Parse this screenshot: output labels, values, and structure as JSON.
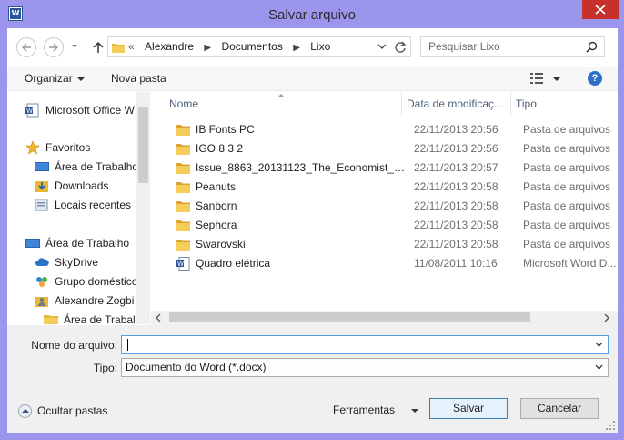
{
  "window": {
    "title": "Salvar arquivo",
    "app_icon_letter": "W"
  },
  "address_bar": {
    "overflow": "«",
    "crumbs": [
      "Alexandre",
      "Documentos",
      "Lixo"
    ]
  },
  "search": {
    "placeholder": "Pesquisar Lixo"
  },
  "toolbar": {
    "organize_label": "Organizar",
    "new_folder_label": "Nova pasta"
  },
  "nav_pane": {
    "items": [
      {
        "label": "Microsoft Office W",
        "icon": "word-doc-icon"
      },
      {
        "label": "Favoritos",
        "icon": "star-icon"
      },
      {
        "label": "Área de Trabalho",
        "icon": "desktop-icon"
      },
      {
        "label": "Downloads",
        "icon": "downloads-folder-icon"
      },
      {
        "label": "Locais recentes",
        "icon": "recent-places-icon"
      },
      {
        "label": "Área de Trabalho",
        "icon": "desktop-icon"
      },
      {
        "label": "SkyDrive",
        "icon": "cloud-icon"
      },
      {
        "label": "Grupo doméstico",
        "icon": "homegroup-icon"
      },
      {
        "label": "Alexandre Zogbi",
        "icon": "user-folder-icon"
      },
      {
        "label": "Área de Trabalh",
        "icon": "folder-icon"
      }
    ]
  },
  "file_list": {
    "columns": {
      "name": "Nome",
      "date": "Data de modificaç...",
      "type": "Tipo"
    },
    "rows": [
      {
        "name": "IB Fonts PC",
        "date": "22/11/2013 20:56",
        "type": "Pasta de arquivos",
        "icon": "folder"
      },
      {
        "name": "IGO 8 3 2",
        "date": "22/11/2013 20:56",
        "type": "Pasta de arquivos",
        "icon": "folder"
      },
      {
        "name": "Issue_8863_20131123_The_Economist_Ful...",
        "date": "22/11/2013 20:57",
        "type": "Pasta de arquivos",
        "icon": "folder"
      },
      {
        "name": "Peanuts",
        "date": "22/11/2013 20:58",
        "type": "Pasta de arquivos",
        "icon": "folder"
      },
      {
        "name": "Sanborn",
        "date": "22/11/2013 20:58",
        "type": "Pasta de arquivos",
        "icon": "folder"
      },
      {
        "name": "Sephora",
        "date": "22/11/2013 20:58",
        "type": "Pasta de arquivos",
        "icon": "folder"
      },
      {
        "name": "Swarovski",
        "date": "22/11/2013 20:58",
        "type": "Pasta de arquivos",
        "icon": "folder"
      },
      {
        "name": "Quadro elétrica",
        "date": "11/08/2011 10:16",
        "type": "Microsoft Word D...",
        "icon": "word"
      }
    ]
  },
  "form": {
    "filename_label": "Nome do arquivo:",
    "filename_value": "",
    "type_label": "Tipo:",
    "type_value": "Documento do Word (*.docx)"
  },
  "footer": {
    "hide_folders_label": "Ocultar pastas",
    "tools_label": "Ferramentas",
    "save_label": "Salvar",
    "cancel_label": "Cancelar"
  },
  "colors": {
    "frame": "#9b95ee",
    "close_button": "#c7312a",
    "folder_yellow": "#e8b838",
    "accent_blue": "#2b579a"
  }
}
